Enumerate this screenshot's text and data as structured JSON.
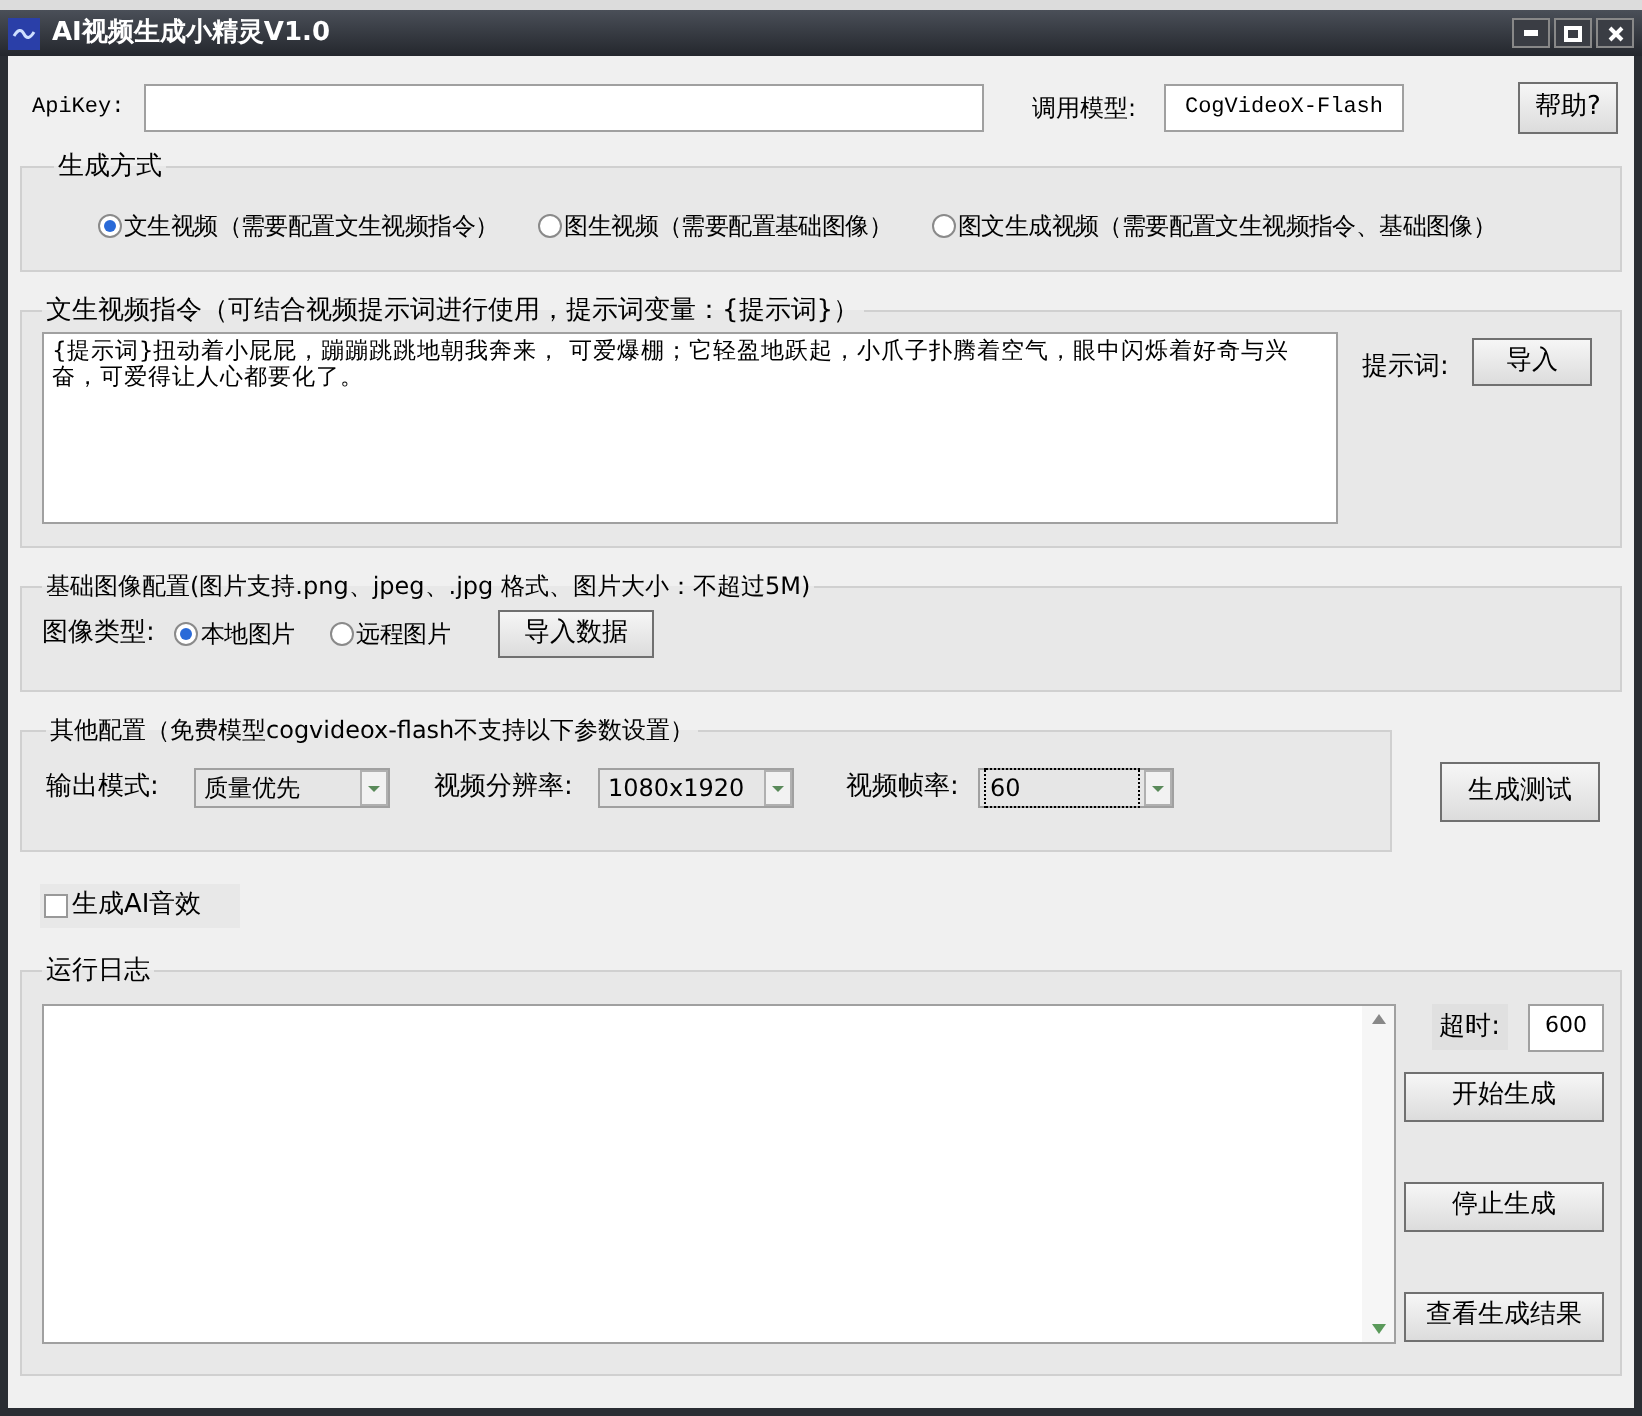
{
  "window": {
    "title": "AI视频生成小精灵V1.0"
  },
  "top_row": {
    "api_label": "ApiKey:",
    "model_label": "调用模型:",
    "model_value": "CogVideoX-Flash",
    "help_button": "帮助?"
  },
  "mode_group": {
    "title": "生成方式",
    "options": [
      {
        "label": "文生视频（需要配置文生视频指令）",
        "selected": true
      },
      {
        "label": "图生视频（需要配置基础图像）",
        "selected": false
      },
      {
        "label": "图文生成视频（需要配置文生视频指令、基础图像）",
        "selected": false
      }
    ]
  },
  "prompt_group": {
    "title": "文生视频指令（可结合视频提示词进行使用，提示词变量：{提示词}）",
    "text": "{提示词}扭动着小屁屁，蹦蹦跳跳地朝我奔来， 可爱爆棚；它轻盈地跃起，小爪子扑腾着空气，眼中闪烁着好奇与兴奋，可爱得让人心都要化了。",
    "prompt_label": "提示词:",
    "import_button": "导入"
  },
  "image_group": {
    "title": "基础图像配置(图片支持.png、jpeg、.jpg 格式、图片大小：不超过5M)",
    "type_label": "图像类型:",
    "options": [
      {
        "label": "本地图片",
        "selected": true
      },
      {
        "label": "远程图片",
        "selected": false
      }
    ],
    "import_button": "导入数据"
  },
  "other_group": {
    "title": "其他配置（免费模型cogvideox-flash不支持以下参数设置）",
    "fields": [
      {
        "label": "输出模式:",
        "value": "质量优先",
        "focused": false
      },
      {
        "label": "视频分辨率:",
        "value": "1080x1920",
        "focused": false
      },
      {
        "label": "视频帧率:",
        "value": "60",
        "focused": true
      }
    ],
    "test_button": "生成测试"
  },
  "audio_checkbox": {
    "label": "生成AI音效",
    "checked": false
  },
  "log_group": {
    "title": "运行日志",
    "timeout_label": "超时:",
    "timeout_value": "600",
    "buttons": [
      "开始生成",
      "停止生成",
      "查看生成结果"
    ]
  }
}
